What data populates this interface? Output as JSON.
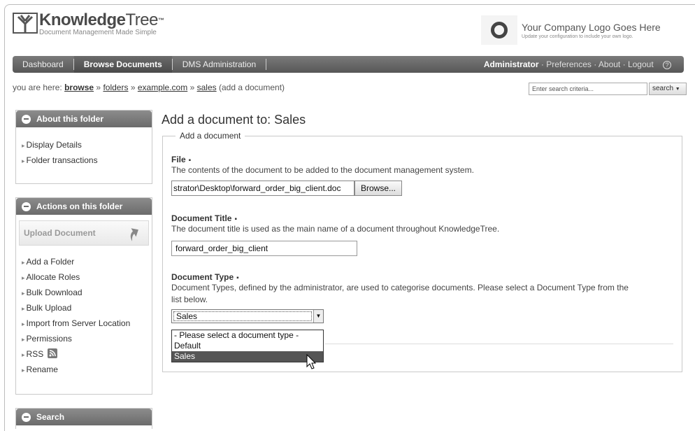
{
  "header": {
    "logo_title_bold": "Knowledge",
    "logo_title_light": "Tree",
    "logo_tm": "™",
    "logo_tagline": "Document Management Made Simple",
    "company_title": "Your Company Logo Goes Here",
    "company_sub": "Update your configuration to include your own logo."
  },
  "nav": {
    "items": [
      {
        "label": "Dashboard"
      },
      {
        "label": "Browse Documents"
      },
      {
        "label": "DMS Administration"
      }
    ],
    "user": "Administrator",
    "preferences": "Preferences",
    "about": "About",
    "logout": "Logout",
    "dot": "·"
  },
  "breadcrumb": {
    "prefix": "you are here:",
    "browse": "browse",
    "folders": "folders",
    "example": "example.com",
    "sales": "sales",
    "suffix": "(add a document)",
    "sep": "»"
  },
  "search": {
    "placeholder": "Enter search criteria...",
    "button": "search"
  },
  "sidebar": {
    "about_title": "About this folder",
    "about_links": [
      "Display Details",
      "Folder transactions"
    ],
    "actions_title": "Actions on this folder",
    "upload_label": "Upload Document",
    "action_links": [
      "Add a Folder",
      "Allocate Roles",
      "Bulk Download",
      "Bulk Upload",
      "Import from Server Location",
      "Permissions",
      "RSS",
      "Rename"
    ],
    "search_title": "Search"
  },
  "main": {
    "title": "Add a document to: Sales",
    "legend": "Add a document",
    "file_label": "File",
    "file_desc": "The contents of the document to be added to the document management system.",
    "file_value": "strator\\Desktop\\forward_order_big_client.doc",
    "browse_label": "Browse...",
    "title_label": "Document Title",
    "title_desc": "The document title is used as the main name of a document throughout KnowledgeTree.",
    "title_value": "forward_order_big_client",
    "type_label": "Document Type",
    "type_desc_1": "Document Types, defined by the administrator, are used to categorise documents. Please select a Document Type from the",
    "type_desc_2": "list below.",
    "type_selected": "Sales",
    "type_options": [
      "- Please select a document type -",
      "Default",
      "Sales"
    ],
    "required_mark": "▪"
  },
  "colors": {
    "nav_bg": "#575757",
    "selected_option_bg": "#555555"
  }
}
